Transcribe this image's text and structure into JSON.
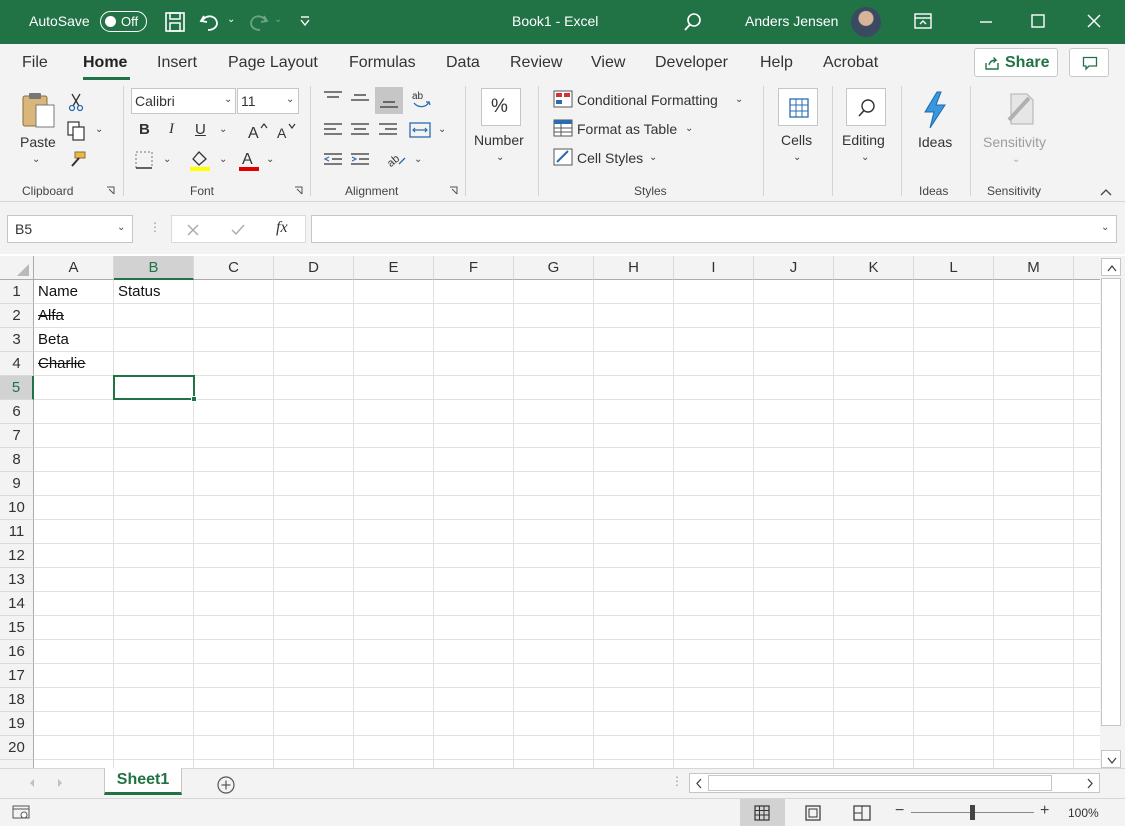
{
  "title_bar": {
    "autosave_label": "AutoSave",
    "autosave_state": "Off",
    "doc_title": "Book1  -  Excel",
    "user_name": "Anders Jensen"
  },
  "menu": {
    "tabs": [
      "File",
      "Home",
      "Insert",
      "Page Layout",
      "Formulas",
      "Data",
      "Review",
      "View",
      "Developer",
      "Help",
      "Acrobat"
    ],
    "active": "Home",
    "share_label": "Share"
  },
  "ribbon": {
    "clipboard": {
      "label": "Clipboard",
      "paste": "Paste"
    },
    "font": {
      "label": "Font",
      "name": "Calibri",
      "size": "11",
      "bold": "B",
      "italic": "I",
      "underline": "U"
    },
    "alignment": {
      "label": "Alignment"
    },
    "number": {
      "label": "Number"
    },
    "styles": {
      "label": "Styles",
      "conditional": "Conditional Formatting",
      "format_table": "Format as Table",
      "cell_styles": "Cell Styles"
    },
    "cells": {
      "label": "Cells"
    },
    "editing": {
      "label": "Editing"
    },
    "ideas": {
      "label": "Ideas",
      "button": "Ideas"
    },
    "sensitivity": {
      "label": "Sensitivity",
      "button": "Sensitivity"
    }
  },
  "formula_bar": {
    "name_box": "B5",
    "fx": "fx",
    "value": ""
  },
  "sheet": {
    "columns": [
      "A",
      "B",
      "C",
      "D",
      "E",
      "F",
      "G",
      "H",
      "I",
      "J",
      "K",
      "L",
      "M"
    ],
    "rows": [
      "1",
      "2",
      "3",
      "4",
      "5",
      "6",
      "7",
      "8",
      "9",
      "10",
      "11",
      "12",
      "13",
      "14",
      "15",
      "16",
      "17",
      "18",
      "19",
      "20"
    ],
    "selected_cell": "B5",
    "cells": {
      "A1": "Name",
      "B1": "Status",
      "A2": "Alfa",
      "A3": "Beta",
      "A4": "Charlie"
    },
    "strikethrough": [
      "A2",
      "A4"
    ]
  },
  "tabs": {
    "sheet1": "Sheet1"
  },
  "status": {
    "zoom": "100%"
  },
  "colors": {
    "accent": "#217346"
  }
}
